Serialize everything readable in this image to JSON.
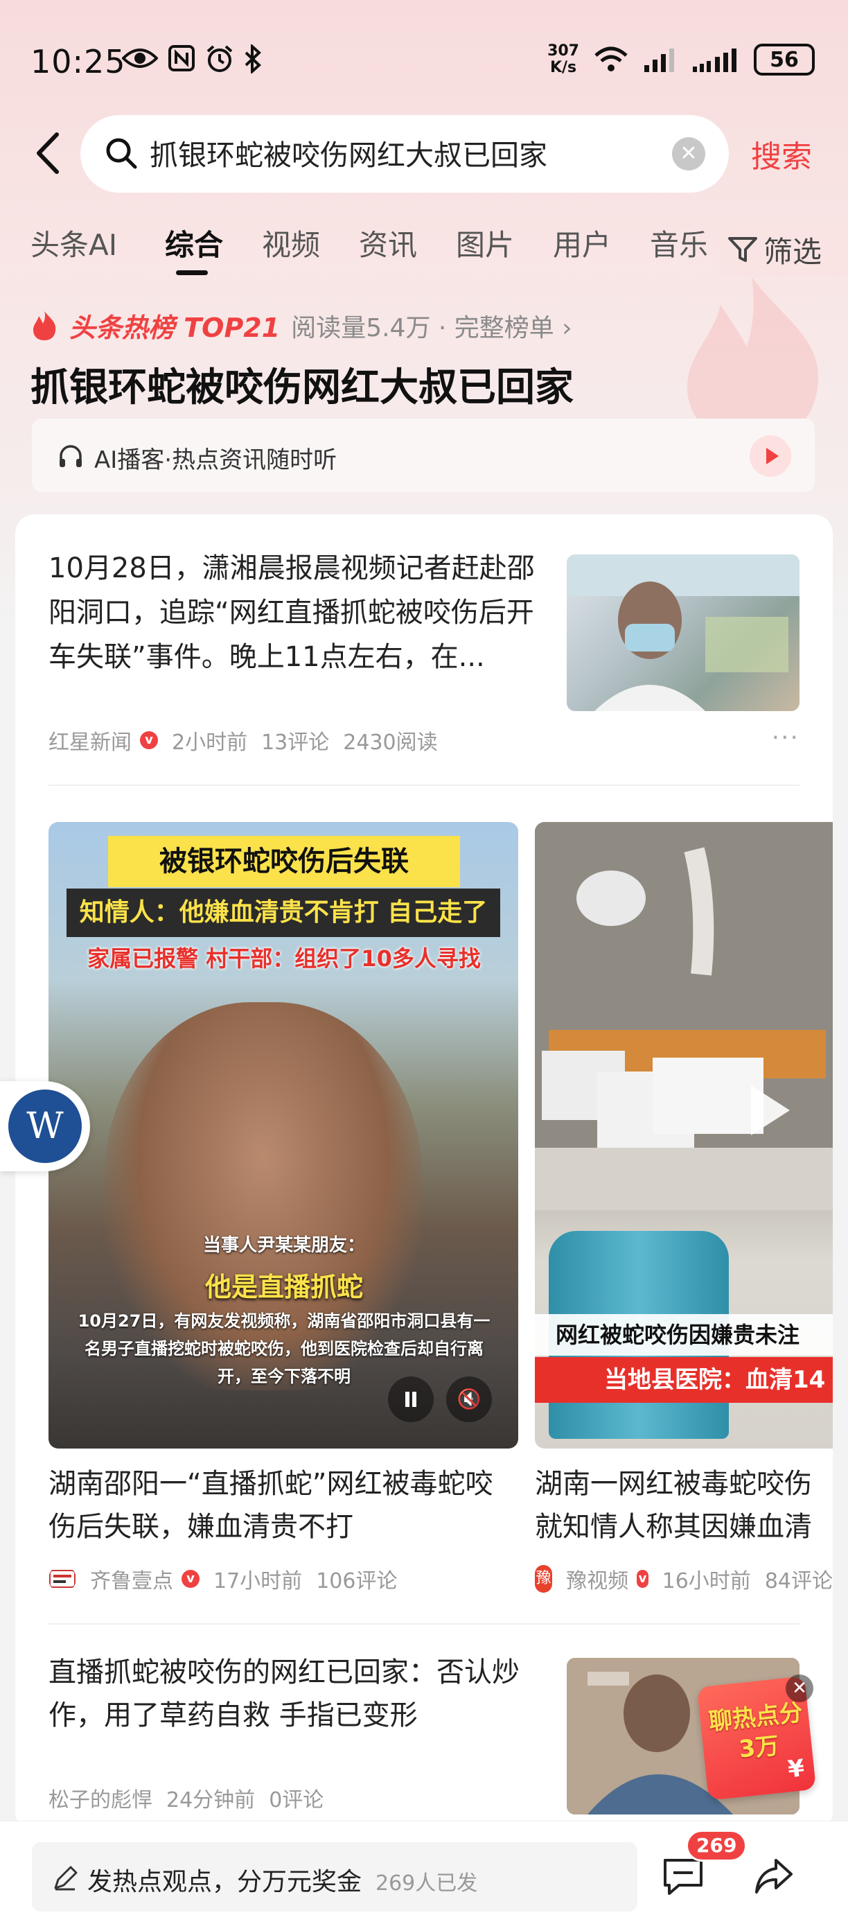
{
  "status_bar": {
    "time": "10:25",
    "icons": [
      "eye-icon",
      "nfc-icon",
      "alarm-icon",
      "bluetooth-icon"
    ],
    "net_speed_value": "307",
    "net_speed_unit": "K/s",
    "battery": "56"
  },
  "search": {
    "query": "抓银环蛇被咬伤网红大叔已回家",
    "button_label": "搜索"
  },
  "tabs": [
    {
      "label": "头条AI",
      "active": false
    },
    {
      "label": "综合",
      "active": true
    },
    {
      "label": "视频",
      "active": false
    },
    {
      "label": "资讯",
      "active": false
    },
    {
      "label": "图片",
      "active": false
    },
    {
      "label": "用户",
      "active": false
    },
    {
      "label": "音乐",
      "active": false
    }
  ],
  "filter_label": "筛选",
  "hot": {
    "badge": "头条热榜 TOP21",
    "meta": "阅读量5.4万 · 完整榜单 ›",
    "title": "抓银环蛇被咬伤网红大叔已回家"
  },
  "podcast": {
    "label": "AI播客·热点资讯随时听"
  },
  "article1": {
    "text": "10月28日，潇湘晨报晨视频记者赶赴邵阳洞口，追踪“网红直播抓蛇被咬伤后开车失联”事件。晚上11点左右，在...",
    "source": "红星新闻",
    "time": "2小时前",
    "comments": "13评论",
    "reads": "2430阅读",
    "verified_mark": "v"
  },
  "video1": {
    "banner_yellow": "被银环蛇咬伤后失联",
    "banner_dark": "知情人：他嫌血清贵不肯打 自己走了",
    "banner_red": "家属已报警 村干部：组织了10多人寻找",
    "friend_label": "当事人尹某某朋友：",
    "friend_quote": "他是直播抓蛇",
    "caption": "10月27日，有网友发视频称，湖南省邵阳市洞口县有一名男子直播挖蛇时被蛇咬伤，他到医院检查后却自行离开，至今下落不明",
    "title": "湖南邵阳一“直播抓蛇”网红被毒蛇咬伤后失联，嫌血清贵不打",
    "source": "齐鲁壹点",
    "time": "17小时前",
    "comments": "106评论"
  },
  "video2": {
    "band1": "网红被蛇咬伤因嫌贵未注",
    "band2": "当地县医院：血清14",
    "title": "湖南一网红被毒蛇咬伤就知情人称其因嫌血清贵",
    "source": "豫视频",
    "logo_char": "豫",
    "time": "16小时前",
    "comments": "84评论"
  },
  "floating_button": "W",
  "article3": {
    "text": "直播抓蛇被咬伤的网红已回家：否认炒作，用了草药自救 手指已变形",
    "source": "松子的彪悍",
    "time": "24分钟前",
    "comments": "0评论"
  },
  "promo": {
    "text": "聊热点分3万",
    "currency": "¥"
  },
  "bottom": {
    "post_label": "发热点观点，分万元奖金",
    "post_count": "269人已发",
    "comment_badge": "269"
  },
  "colors": {
    "accent": "#f04142",
    "background_top": "#f7dcdc"
  }
}
